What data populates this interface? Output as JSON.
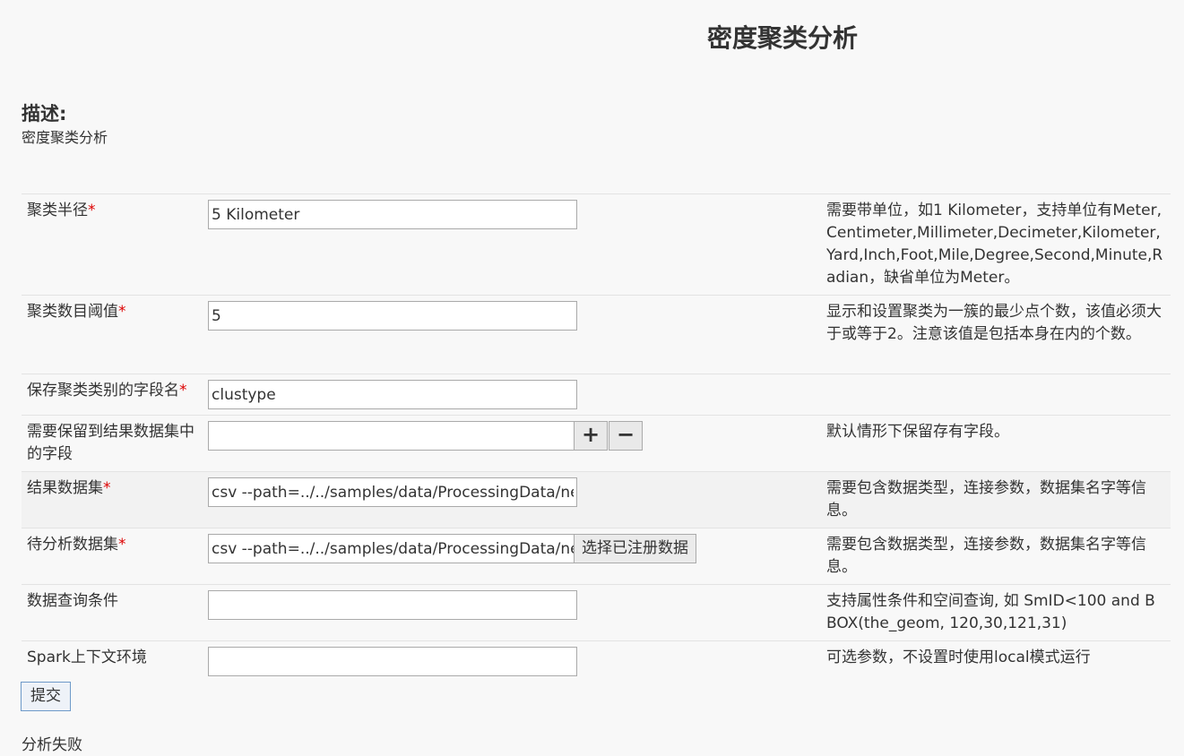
{
  "page_title": "密度聚类分析",
  "description": {
    "heading": "描述:",
    "text": "密度聚类分析"
  },
  "required_mark": "*",
  "params": [
    {
      "label": "聚类半径",
      "required": true,
      "value": "5 Kilometer",
      "help": "需要带单位，如1 Kilometer，支持单位有Meter,Centimeter,Millimeter,Decimeter,Kilometer,Yard,Inch,Foot,Mile,Degree,Second,Minute,Radian，缺省单位为Meter。"
    },
    {
      "label": "聚类数目阈值",
      "required": true,
      "value": "5",
      "help": "显示和设置聚类为一簇的最少点个数，该值必须大于或等于2。注意该值是包括本身在内的个数。"
    },
    {
      "label": "保存聚类类别的字段名",
      "required": true,
      "value": "clustype",
      "help": ""
    },
    {
      "label": "需要保留到结果数据集中的字段",
      "required": false,
      "value": "",
      "help": "默认情形下保留存有字段。",
      "add_icon": "plus-icon",
      "remove_icon": "minus-icon"
    },
    {
      "label": "结果数据集",
      "required": true,
      "value": "csv --path=../../samples/data/ProcessingData/ne",
      "help": "需要包含数据类型，连接参数，数据集名字等信息。"
    },
    {
      "label": "待分析数据集",
      "required": true,
      "value": "csv --path=../../samples/data/ProcessingData/ne",
      "help": "需要包含数据类型，连接参数，数据集名字等信息。",
      "button": "选择已注册数据"
    },
    {
      "label": "数据查询条件",
      "required": false,
      "value": "",
      "help": "支持属性条件和空间查询, 如 SmID<100 and BBOX(the_geom, 120,30,121,31)"
    },
    {
      "label": "Spark上下文环境",
      "required": false,
      "value": "",
      "help": "可选参数，不设置时使用local模式运行"
    }
  ],
  "submit_label": "提交",
  "result_text": "分析失败"
}
